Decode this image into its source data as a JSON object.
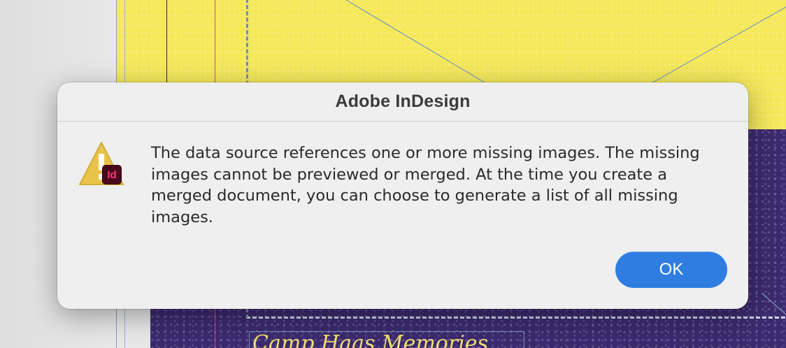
{
  "dialog": {
    "title": "Adobe InDesign",
    "icon": "warning-icon",
    "app_badge": "Id",
    "message": "The data source references one or more missing images. The missing images cannot be previewed or merged. At the time you create a merged document, you can choose to generate a list of all missing images.",
    "ok_label": "OK"
  },
  "document": {
    "script_heading": "Camp Haas Memories"
  },
  "colors": {
    "accent": "#2f7de0",
    "page_yellow": "#f5e85a",
    "page_purple": "#3c2a6e",
    "warning_yellow": "#e9c44a",
    "badge_bg": "#4a0a1d",
    "badge_text": "#ff3b76"
  }
}
